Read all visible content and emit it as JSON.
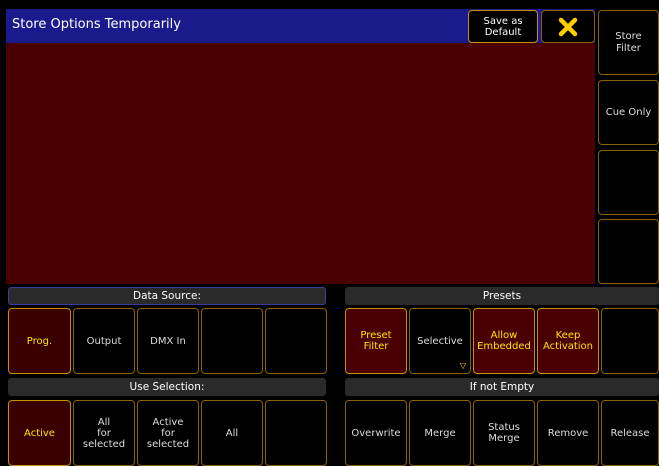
{
  "window": {
    "title": "Store Options Temporarily",
    "save_default_label": "Save as\nDefault",
    "close_icon": "close-x-icon",
    "accent_color": "#ffe600",
    "title_bg": "#1a1a8c"
  },
  "side_buttons": [
    {
      "label": "Store\nFilter"
    },
    {
      "label": "Cue Only"
    },
    {
      "label": ""
    },
    {
      "label": ""
    }
  ],
  "data_source": {
    "header": "Data Source:",
    "buttons": [
      {
        "label": "Prog.",
        "active": true
      },
      {
        "label": "Output",
        "active": false
      },
      {
        "label": "DMX In",
        "active": false
      },
      {
        "label": "",
        "active": false
      },
      {
        "label": "",
        "active": false
      }
    ]
  },
  "presets": {
    "header": "Presets",
    "buttons": [
      {
        "label": "Preset\nFilter",
        "active": true
      },
      {
        "label": "Selective",
        "active": false
      },
      {
        "label": "Allow\nEmbedded",
        "active": true
      },
      {
        "label": "Keep\nActivation",
        "active": true
      },
      {
        "label": "",
        "active": false
      }
    ]
  },
  "use_selection": {
    "header": "Use Selection:",
    "buttons": [
      {
        "label": "Active",
        "active": true
      },
      {
        "label": "All\nfor\nselected",
        "active": false
      },
      {
        "label": "Active\nfor\nselected",
        "active": false
      },
      {
        "label": "All",
        "active": false
      },
      {
        "label": "",
        "active": false
      }
    ]
  },
  "if_not_empty": {
    "header": "If not Empty",
    "buttons": [
      {
        "label": "Overwrite",
        "active": false
      },
      {
        "label": "Merge",
        "active": false
      },
      {
        "label": "Status\nMerge",
        "active": false
      },
      {
        "label": "Remove",
        "active": false
      },
      {
        "label": "Release",
        "active": false
      }
    ]
  }
}
